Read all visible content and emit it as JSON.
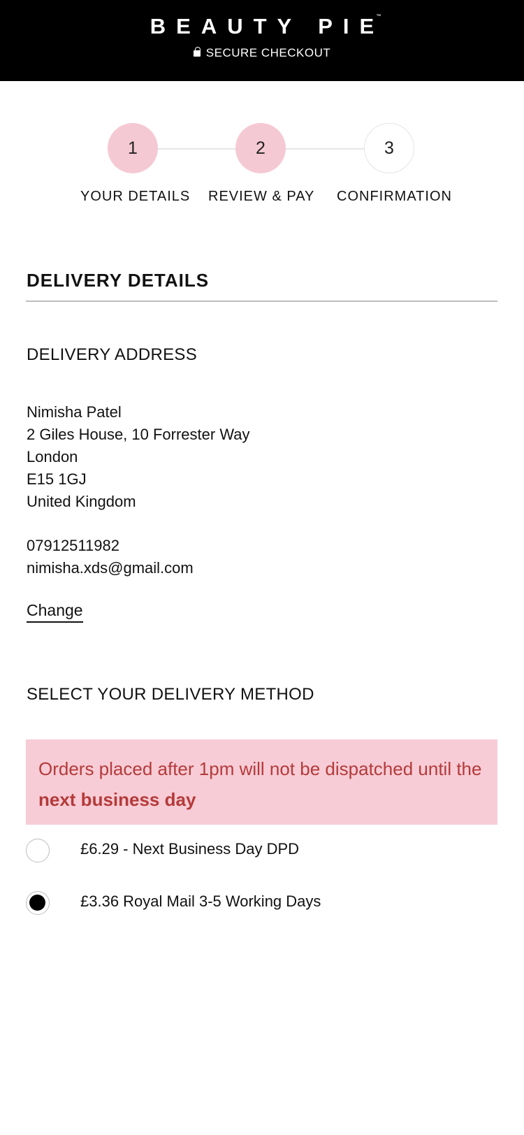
{
  "header": {
    "brand": "BEAUTY PIE",
    "trademark": "™",
    "secure_label": "SECURE CHECKOUT"
  },
  "stepper": {
    "steps": [
      {
        "number": "1",
        "label": "YOUR DETAILS",
        "state": "completed"
      },
      {
        "number": "2",
        "label": "REVIEW & PAY",
        "state": "completed"
      },
      {
        "number": "3",
        "label": "CONFIRMATION",
        "state": "pending"
      }
    ]
  },
  "delivery": {
    "title": "DELIVERY DETAILS",
    "address_heading": "DELIVERY ADDRESS",
    "address": {
      "name": "Nimisha Patel",
      "line1": "2 Giles House, 10 Forrester Way",
      "city": "London",
      "postcode": "E15 1GJ",
      "country": "United Kingdom",
      "phone": "07912511982",
      "email": "nimisha.xds@gmail.com"
    },
    "change_label": "Change",
    "method_heading": "SELECT YOUR DELIVERY METHOD",
    "notice": {
      "text_before": "Orders placed after 1pm will not be dispatched until the ",
      "text_bold": "next business day"
    },
    "options": [
      {
        "label": "£6.29 - Next Business Day DPD",
        "selected": false
      },
      {
        "label": "£3.36 Royal Mail 3-5 Working Days",
        "selected": true
      }
    ]
  },
  "colors": {
    "header_bg": "#000000",
    "step_active": "#f5c9d3",
    "notice_bg": "#f7ccd6",
    "notice_text": "#b53a3a"
  }
}
